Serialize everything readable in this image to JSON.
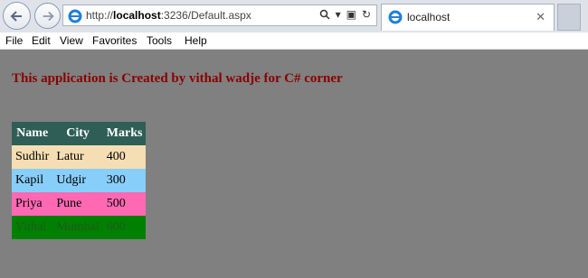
{
  "browser": {
    "address": {
      "prefix": "http://",
      "host": "localhost",
      "rest": ":3236/Default.aspx"
    },
    "tab": {
      "title": "localhost"
    },
    "icons": {
      "back": "back-arrow-icon",
      "forward": "forward-arrow-icon",
      "search": "search-icon",
      "refresh": "refresh-icon",
      "close": "close-icon"
    }
  },
  "menu": [
    "File",
    "Edit",
    "View",
    "Favorites",
    "Tools",
    "Help"
  ],
  "page": {
    "heading": "This application is Created by vithal wadje for C# corner",
    "table": {
      "headers": [
        "Name",
        "City",
        "Marks"
      ],
      "rows": [
        [
          "Sudhir",
          "Latur",
          "400"
        ],
        [
          "Kapil",
          "Udgir",
          "300"
        ],
        [
          "Priya",
          "Pune",
          "500"
        ],
        [
          "Vithal",
          "Mumbai",
          "600"
        ]
      ],
      "row_colors": [
        {
          "bg": "#f5deb3",
          "fg": "#000000"
        },
        {
          "bg": "#87cefa",
          "fg": "#000000"
        },
        {
          "bg": "#ff69b4",
          "fg": "#000000"
        },
        {
          "bg": "#008000",
          "fg": "#1f5a1f"
        }
      ]
    }
  }
}
